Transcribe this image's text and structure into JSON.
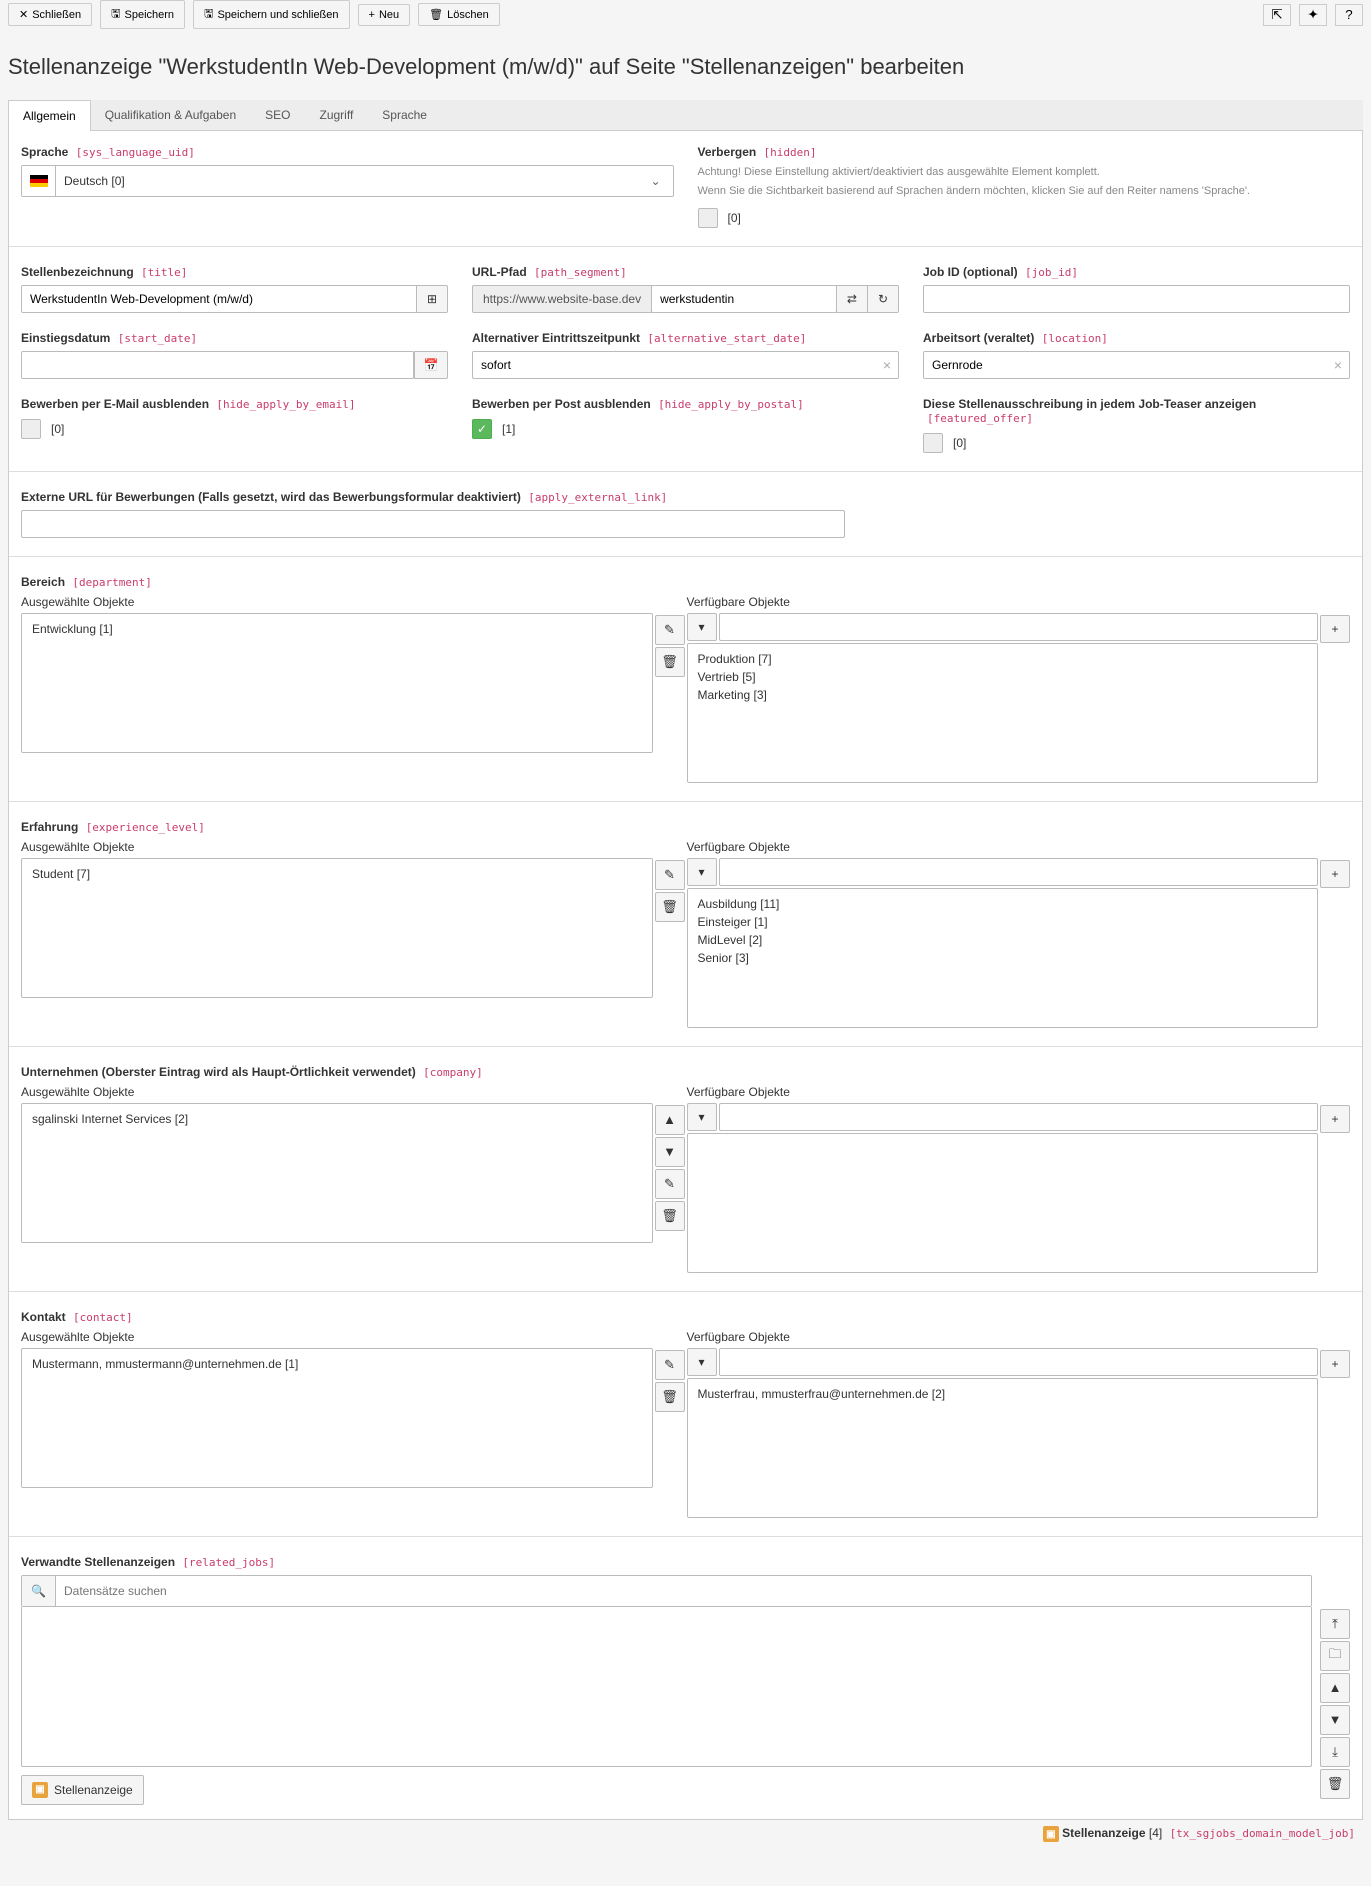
{
  "toolbar": {
    "close": "Schließen",
    "save": "Speichern",
    "save_close": "Speichern und schließen",
    "new": "Neu",
    "delete": "Löschen"
  },
  "page_title": "Stellenanzeige \"WerkstudentIn Web-Development (m/w/d)\" auf Seite \"Stellenanzeigen\" bearbeiten",
  "tabs": [
    "Allgemein",
    "Qualifikation & Aufgaben",
    "SEO",
    "Zugriff",
    "Sprache"
  ],
  "language": {
    "label": "Sprache",
    "tech": "[sys_language_uid]",
    "value": "Deutsch [0]"
  },
  "hidden": {
    "label": "Verbergen",
    "tech": "[hidden]",
    "hint1": "Achtung! Diese Einstellung aktiviert/deaktiviert das ausgewählte Element komplett.",
    "hint2": "Wenn Sie die Sichtbarkeit basierend auf Sprachen ändern möchten, klicken Sie auf den Reiter namens 'Sprache'.",
    "val": "[0]"
  },
  "title": {
    "label": "Stellenbezeichnung",
    "tech": "[title]",
    "value": "WerkstudentIn Web-Development (m/w/d)"
  },
  "url": {
    "label": "URL-Pfad",
    "tech": "[path_segment]",
    "base": "https://www.website-base.dev",
    "value": "werkstudentin"
  },
  "jobid": {
    "label": "Job ID (optional)",
    "tech": "[job_id]"
  },
  "startdate": {
    "label": "Einstiegsdatum",
    "tech": "[start_date]"
  },
  "altstart": {
    "label": "Alternativer Eintrittszeitpunkt",
    "tech": "[alternative_start_date]",
    "value": "sofort"
  },
  "location": {
    "label": "Arbeitsort (veraltet)",
    "tech": "[location]",
    "value": "Gernrode"
  },
  "hide_email": {
    "label": "Bewerben per E-Mail ausblenden",
    "tech": "[hide_apply_by_email]",
    "val": "[0]"
  },
  "hide_postal": {
    "label": "Bewerben per Post ausblenden",
    "tech": "[hide_apply_by_postal]",
    "val": "[1]"
  },
  "featured": {
    "label": "Diese Stellenausschreibung in jedem Job-Teaser anzeigen",
    "tech": "[featured_offer]",
    "val": "[0]"
  },
  "external_url": {
    "label": "Externe URL für Bewerbungen (Falls gesetzt, wird das Bewerbungsformular deaktiviert)",
    "tech": "[apply_external_link]"
  },
  "department": {
    "label": "Bereich",
    "tech": "[department]",
    "sel_label": "Ausgewählte Objekte",
    "avail_label": "Verfügbare Objekte",
    "selected": [
      "Entwicklung [1]"
    ],
    "available": [
      "Produktion [7]",
      "Vertrieb [5]",
      "Marketing [3]"
    ]
  },
  "experience": {
    "label": "Erfahrung",
    "tech": "[experience_level]",
    "sel_label": "Ausgewählte Objekte",
    "avail_label": "Verfügbare Objekte",
    "selected": [
      "Student [7]"
    ],
    "available": [
      "Ausbildung [11]",
      "Einsteiger [1]",
      "MidLevel [2]",
      "Senior [3]"
    ]
  },
  "company": {
    "label": "Unternehmen (Oberster Eintrag wird als Haupt-Örtlichkeit verwendet)",
    "tech": "[company]",
    "sel_label": "Ausgewählte Objekte",
    "avail_label": "Verfügbare Objekte",
    "selected": [
      "sgalinski Internet Services [2]"
    ],
    "available": []
  },
  "contact": {
    "label": "Kontakt",
    "tech": "[contact]",
    "sel_label": "Ausgewählte Objekte",
    "avail_label": "Verfügbare Objekte",
    "selected": [
      "Mustermann, mmustermann@unternehmen.de [1]"
    ],
    "available": [
      "Musterfrau, mmusterfrau@unternehmen.de [2]"
    ]
  },
  "related": {
    "label": "Verwandte Stellenanzeigen",
    "tech": "[related_jobs]",
    "placeholder": "Datensätze suchen",
    "btn": "Stellenanzeige"
  },
  "footer": {
    "text": "Stellenanzeige",
    "count": "[4]",
    "tech": "[tx_sgjobs_domain_model_job]"
  }
}
